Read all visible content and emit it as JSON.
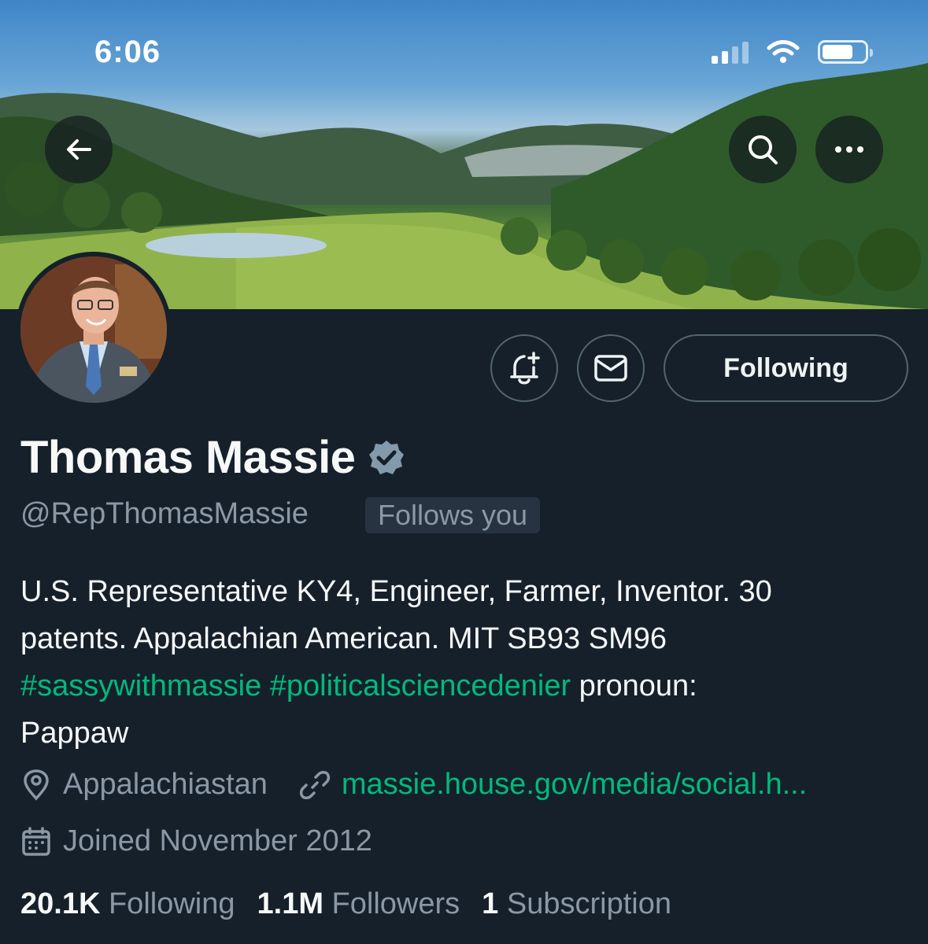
{
  "status_bar": {
    "time": "6:06"
  },
  "header": {
    "back": "back-arrow-icon",
    "search": "search-icon",
    "more": "more-icon"
  },
  "profile": {
    "name": "Thomas Massie",
    "verified": true,
    "handle": "@RepThomasMassie",
    "follows_you": "Follows you",
    "follow_button": "Following",
    "bio": {
      "line1": "U.S. Representative KY4, Engineer, Farmer, Inventor. 30",
      "line2": "patents. Appalachian American. MIT SB93 SM96",
      "hashtag1": "#sassywithmassie",
      "hashtag2": "#politicalsciencedenier",
      "line3_rest": " pronoun:",
      "line4": "Pappaw"
    },
    "location": "Appalachiastan",
    "website": "massie.house.gov/media/social.h...",
    "joined": "Joined November 2012",
    "stats": {
      "following_count": "20.1K",
      "following_label": "Following",
      "followers_count": "1.1M",
      "followers_label": "Followers",
      "subscriptions_count": "1",
      "subscriptions_label": "Subscription"
    }
  },
  "colors": {
    "background": "#15202b",
    "accent_green": "#00ba7c",
    "secondary_text": "#8b98a5",
    "border": "#536471"
  }
}
